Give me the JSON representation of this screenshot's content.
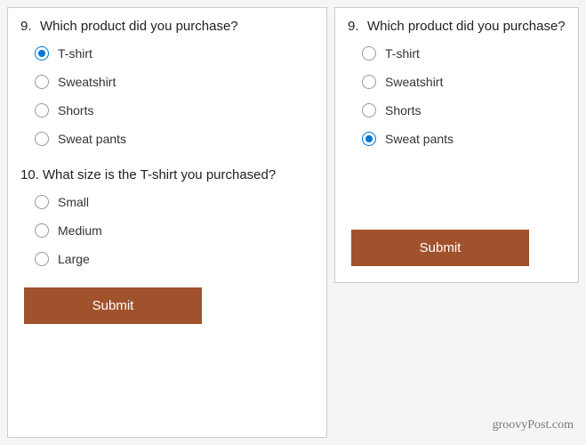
{
  "left": {
    "q9": {
      "number": "9.",
      "text": "Which product did you purchase?",
      "options": [
        "T-shirt",
        "Sweatshirt",
        "Shorts",
        "Sweat pants"
      ],
      "selected": 0
    },
    "q10": {
      "number": "10.",
      "text": "What size is the T-shirt you purchased?",
      "options": [
        "Small",
        "Medium",
        "Large"
      ],
      "selected": -1
    },
    "submit_label": "Submit"
  },
  "right": {
    "q9": {
      "number": "9.",
      "text": "Which product did you purchase?",
      "options": [
        "T-shirt",
        "Sweatshirt",
        "Shorts",
        "Sweat pants"
      ],
      "selected": 3
    },
    "submit_label": "Submit"
  },
  "watermark": "groovyPost.com"
}
